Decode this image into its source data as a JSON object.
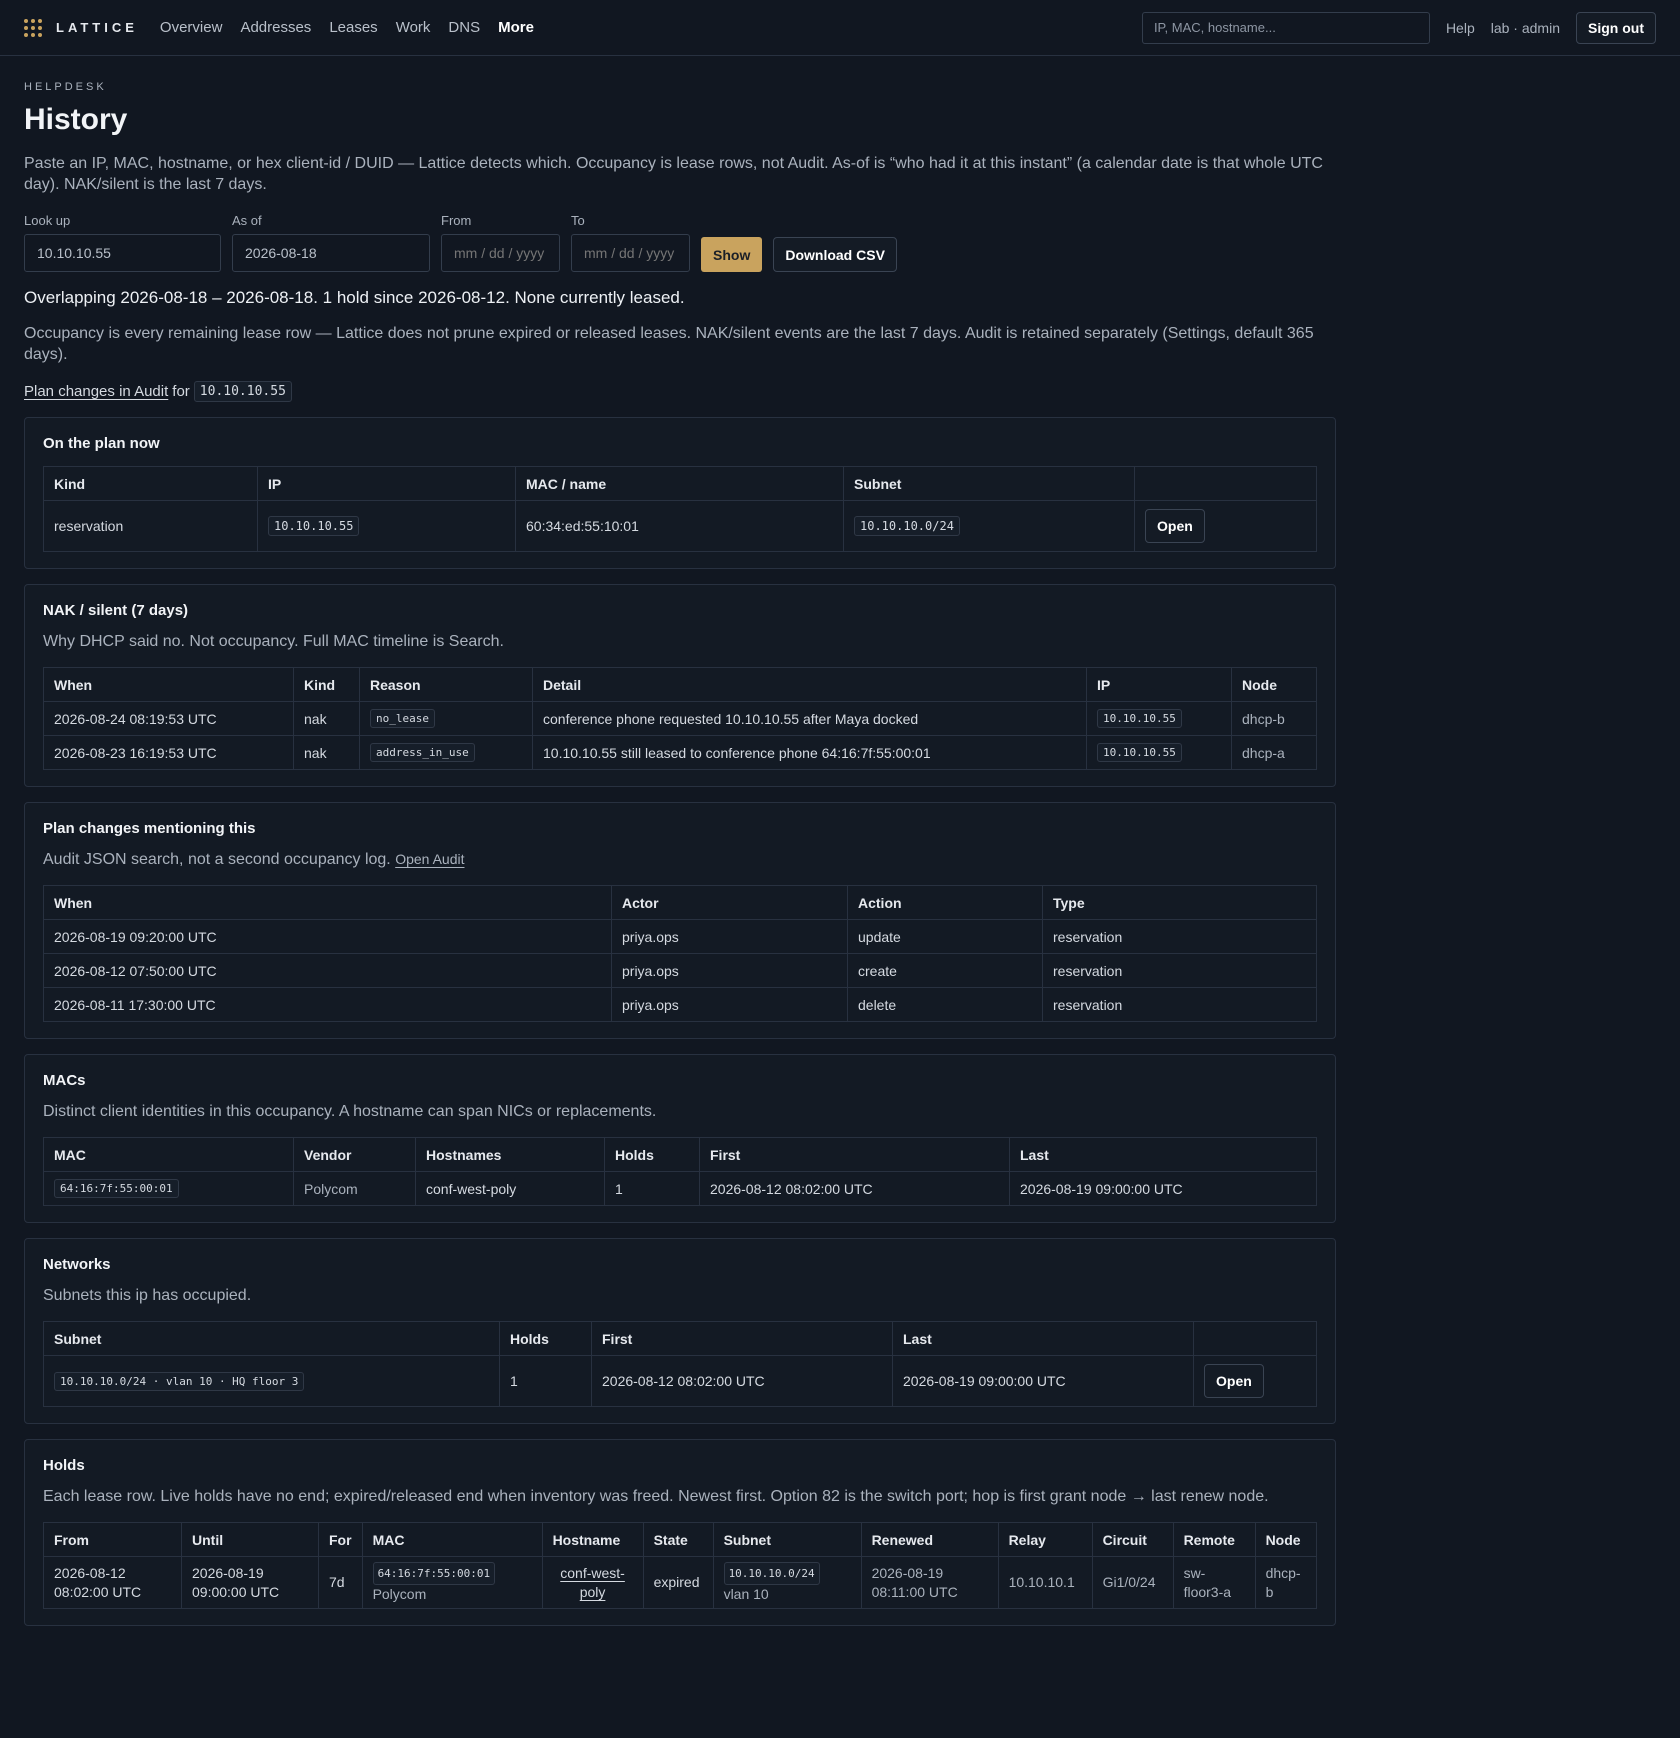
{
  "topbar": {
    "logo": "LATTICE",
    "nav": [
      "Overview",
      "Addresses",
      "Leases",
      "Work",
      "DNS",
      "More"
    ],
    "search_placeholder": "IP, MAC, hostname...",
    "help": "Help",
    "user": "lab · admin",
    "signout": "Sign out"
  },
  "page": {
    "eyebrow": "HELPDESK",
    "title": "History",
    "lead": "Paste an IP, MAC, hostname, or hex client-id / DUID — Lattice detects which. Occupancy is lease rows, not Audit. As-of is “who had it at this instant” (a calendar date is that whole UTC day). NAK/silent is the last 7 days."
  },
  "form": {
    "lookup_label": "Look up",
    "lookup_value": "10.10.10.55",
    "asof_label": "As of",
    "asof_value": "2026-08-18",
    "from_label": "From",
    "from_placeholder": "mm / dd / yyyy",
    "to_label": "To",
    "to_placeholder": "mm / dd / yyyy",
    "show": "Show",
    "csv": "Download CSV"
  },
  "summary": "Overlapping 2026-08-18 – 2026-08-18. 1 hold since 2026-08-12. None currently leased.",
  "note": "Occupancy is every remaining lease row — Lattice does not prune expired or released leases. NAK/silent events are the last 7 days. Audit is retained separately (Settings, default 365 days).",
  "planline": {
    "link": "Plan changes in Audit",
    "for": "for",
    "ip": "10.10.10.55"
  },
  "onplan": {
    "title": "On the plan now",
    "headers": [
      "Kind",
      "IP",
      "MAC / name",
      "Subnet",
      ""
    ],
    "row": {
      "kind": "reservation",
      "ip": "10.10.10.55",
      "mac": "60:34:ed:55:10:01",
      "subnet": "10.10.10.0/24",
      "open": "Open"
    }
  },
  "nak": {
    "title": "NAK / silent (7 days)",
    "sub": "Why DHCP said no. Not occupancy. Full MAC timeline is Search.",
    "headers": [
      "When",
      "Kind",
      "Reason",
      "Detail",
      "IP",
      "Node"
    ],
    "rows": [
      {
        "when": "2026-08-24 08:19:53 UTC",
        "kind": "nak",
        "reason": "no_lease",
        "detail": "conference phone requested 10.10.10.55 after Maya docked",
        "ip": "10.10.10.55",
        "node": "dhcp-b"
      },
      {
        "when": "2026-08-23 16:19:53 UTC",
        "kind": "nak",
        "reason": "address_in_use",
        "detail": "10.10.10.55 still leased to conference phone 64:16:7f:55:00:01",
        "ip": "10.10.10.55",
        "node": "dhcp-a"
      }
    ]
  },
  "plan": {
    "title": "Plan changes mentioning this",
    "sub": "Audit JSON search, not a second occupancy log.",
    "sub_link": "Open Audit",
    "headers": [
      "When",
      "Actor",
      "Action",
      "Type"
    ],
    "rows": [
      {
        "when": "2026-08-19 09:20:00 UTC",
        "actor": "priya.ops",
        "action": "update",
        "type": "reservation"
      },
      {
        "when": "2026-08-12 07:50:00 UTC",
        "actor": "priya.ops",
        "action": "create",
        "type": "reservation"
      },
      {
        "when": "2026-08-11 17:30:00 UTC",
        "actor": "priya.ops",
        "action": "delete",
        "type": "reservation"
      }
    ]
  },
  "macs": {
    "title": "MACs",
    "sub": "Distinct client identities in this occupancy. A hostname can span NICs or replacements.",
    "headers": [
      "MAC",
      "Vendor",
      "Hostnames",
      "Holds",
      "First",
      "Last"
    ],
    "row": {
      "mac": "64:16:7f:55:00:01",
      "vendor": "Polycom",
      "hostnames": "conf-west-poly",
      "holds": "1",
      "first": "2026-08-12 08:02:00 UTC",
      "last": "2026-08-19 09:00:00 UTC"
    }
  },
  "networks": {
    "title": "Networks",
    "sub": "Subnets this ip has occupied.",
    "headers": [
      "Subnet",
      "Holds",
      "First",
      "Last",
      ""
    ],
    "row": {
      "subnet": "10.10.10.0/24 · vlan 10 · HQ floor 3",
      "holds": "1",
      "first": "2026-08-12 08:02:00 UTC",
      "last": "2026-08-19 09:00:00 UTC",
      "open": "Open"
    }
  },
  "holds": {
    "title": "Holds",
    "sub": "Each lease row. Live holds have no end; expired/released end when inventory was freed. Newest first. Option 82 is the switch port; hop is first grant node → last renew node.",
    "headers": [
      "From",
      "Until",
      "For",
      "MAC",
      "Hostname",
      "State",
      "Subnet",
      "Renewed",
      "Relay",
      "Circuit",
      "Remote",
      "Node"
    ],
    "row": {
      "from_date": "2026-08-12",
      "from_time": "08:02:00 UTC",
      "until_date": "2026-08-19",
      "until_time": "09:00:00 UTC",
      "for": "7d",
      "mac": "64:16:7f:55:00:01",
      "vendor": "Polycom",
      "host1": "conf-west-",
      "host2": "poly",
      "state": "expired",
      "subnet": "10.10.10.0/24",
      "vlan": "vlan 10",
      "renewed_date": "2026-08-19",
      "renewed_time": "08:11:00 UTC",
      "relay": "10.10.10.1",
      "circuit": "Gi1/0/24",
      "remote1": "sw-",
      "remote2": "floor3-a",
      "node1": "dhcp-",
      "node2": "b"
    }
  }
}
